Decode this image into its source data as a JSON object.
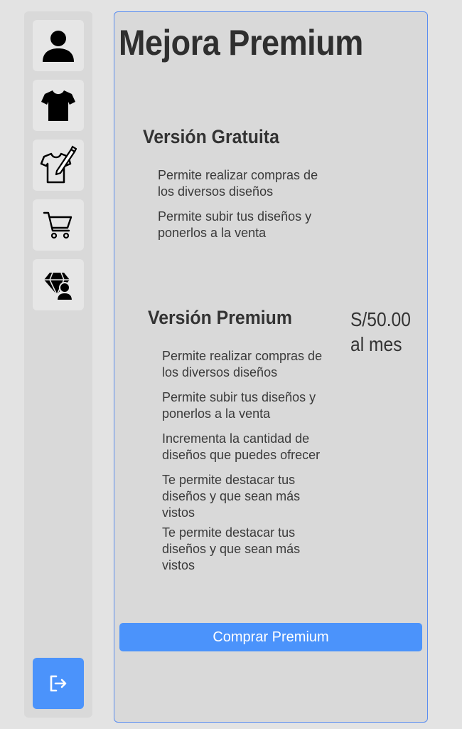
{
  "sidebar": {
    "items": [
      {
        "icon": "user-icon"
      },
      {
        "icon": "tshirt-icon"
      },
      {
        "icon": "design-tshirt-icon"
      },
      {
        "icon": "cart-icon"
      },
      {
        "icon": "premium-diamond-user-icon"
      }
    ],
    "logout": {
      "icon": "logout-icon"
    }
  },
  "main": {
    "title": "Mejora Premium",
    "free": {
      "heading": "Versión Gratuita",
      "features": [
        "Permite realizar compras de los diversos diseños",
        "Permite subir tus diseños y ponerlos a la venta"
      ]
    },
    "premium": {
      "heading": "Versión Premium",
      "price": "S/50.00",
      "period": "al mes",
      "features": [
        "Permite realizar compras de los diversos diseños",
        "Permite subir tus diseños y ponerlos a la venta",
        "Incrementa la cantidad de diseños que puedes ofrecer",
        "Te permite destacar tus diseños y que sean más vistos",
        "Te permite destacar tus diseños y que sean más vistos"
      ]
    },
    "buy_button": "Comprar Premium"
  },
  "colors": {
    "accent": "#4b93fb",
    "panel_border": "#5b8ef0",
    "background": "#e3e3e3",
    "panel": "#d9d9d9"
  }
}
